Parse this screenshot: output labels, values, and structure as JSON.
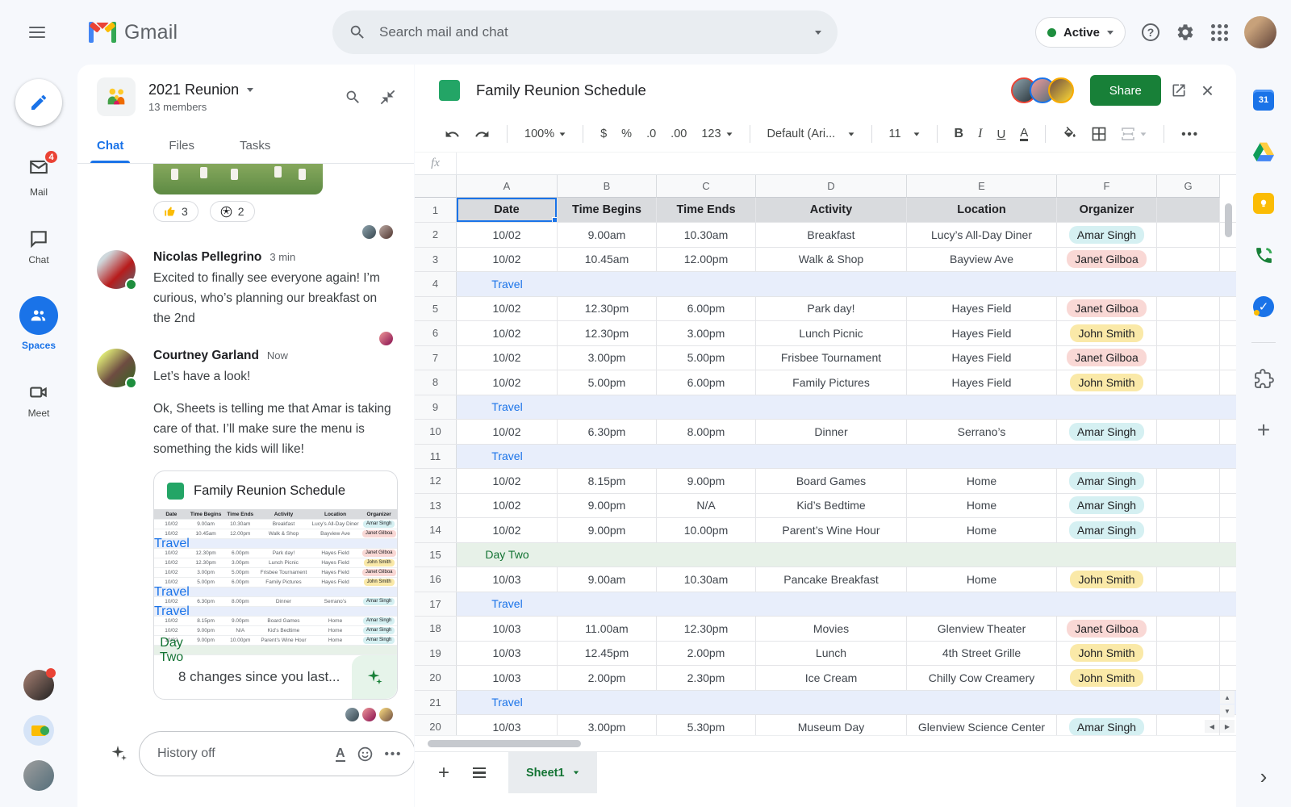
{
  "topbar": {
    "product": "Gmail",
    "search_placeholder": "Search mail and chat",
    "status": "Active"
  },
  "left_nav": {
    "items": [
      {
        "label": "Mail",
        "badge": "4"
      },
      {
        "label": "Chat"
      },
      {
        "label": "Spaces"
      },
      {
        "label": "Meet"
      }
    ]
  },
  "chat": {
    "space_title": "2021 Reunion",
    "members": "13 members",
    "tabs": [
      {
        "label": "Chat"
      },
      {
        "label": "Files"
      },
      {
        "label": "Tasks"
      }
    ],
    "reactions": [
      {
        "icon": "thumbs-up",
        "count": "3"
      },
      {
        "icon": "soccer-ball",
        "count": "2"
      }
    ],
    "messages": {
      "0": {
        "author": "Nicolas Pellegrino",
        "time": "3 min",
        "text": "Excited to finally see everyone again! I’m curious, who’s planning our breakfast on the 2nd"
      },
      "1": {
        "author": "Courtney Garland",
        "time": "Now",
        "text": "Let’s have a look!",
        "text2": "Ok, Sheets is telling me that Amar is taking care of that. I’ll make sure the menu is something the kids will like!"
      }
    },
    "card": {
      "title": "Family Reunion Schedule",
      "footer": "8 changes since you last..."
    },
    "composer": {
      "placeholder": "History off"
    }
  },
  "sheet": {
    "title": "Family Reunion Schedule",
    "share_label": "Share",
    "toolbar": {
      "zoom": "100%",
      "currency": "$",
      "percent": "%",
      "dec0": ".0",
      "dec00": ".00",
      "fmt": "123",
      "font": "Default (Ari...",
      "size": "11",
      "bold": "B",
      "italic": "I",
      "underline": "U",
      "textcolor": "A"
    },
    "formula_label": "fx",
    "columns": [
      "A",
      "B",
      "C",
      "D",
      "E",
      "F",
      "G"
    ],
    "header_row": [
      "Date",
      "Time Begins",
      "Time Ends",
      "Activity",
      "Location",
      "Organizer"
    ],
    "rows": [
      {
        "n": "2",
        "type": "data",
        "cells": [
          "10/02",
          "9.00am",
          "10.30am",
          "Breakfast",
          "Lucy’s All-Day Diner"
        ],
        "organizer": "Amar Singh",
        "chip": "cyan"
      },
      {
        "n": "3",
        "type": "data",
        "cells": [
          "10/02",
          "10.45am",
          "12.00pm",
          "Walk & Shop",
          "Bayview Ave"
        ],
        "organizer": "Janet Gilboa",
        "chip": "pink"
      },
      {
        "n": "4",
        "type": "travel",
        "label": "Travel"
      },
      {
        "n": "5",
        "type": "data",
        "cells": [
          "10/02",
          "12.30pm",
          "6.00pm",
          "Park day!",
          "Hayes Field"
        ],
        "organizer": "Janet Gilboa",
        "chip": "pink"
      },
      {
        "n": "6",
        "type": "data",
        "cells": [
          "10/02",
          "12.30pm",
          "3.00pm",
          "Lunch Picnic",
          "Hayes Field"
        ],
        "organizer": "John Smith",
        "chip": "yellow"
      },
      {
        "n": "7",
        "type": "data",
        "cells": [
          "10/02",
          "3.00pm",
          "5.00pm",
          "Frisbee Tournament",
          "Hayes Field"
        ],
        "organizer": "Janet Gilboa",
        "chip": "pink"
      },
      {
        "n": "8",
        "type": "data",
        "cells": [
          "10/02",
          "5.00pm",
          "6.00pm",
          "Family Pictures",
          "Hayes Field"
        ],
        "organizer": "John Smith",
        "chip": "yellow"
      },
      {
        "n": "9",
        "type": "travel",
        "label": "Travel"
      },
      {
        "n": "10",
        "type": "data",
        "cells": [
          "10/02",
          "6.30pm",
          "8.00pm",
          "Dinner",
          "Serrano’s"
        ],
        "organizer": "Amar Singh",
        "chip": "cyan"
      },
      {
        "n": "11",
        "type": "travel",
        "label": "Travel"
      },
      {
        "n": "12",
        "type": "data",
        "cells": [
          "10/02",
          "8.15pm",
          "9.00pm",
          "Board Games",
          "Home"
        ],
        "organizer": "Amar Singh",
        "chip": "cyan"
      },
      {
        "n": "13",
        "type": "data",
        "cells": [
          "10/02",
          "9.00pm",
          "N/A",
          "Kid’s Bedtime",
          "Home"
        ],
        "organizer": "Amar Singh",
        "chip": "cyan"
      },
      {
        "n": "14",
        "type": "data",
        "cells": [
          "10/02",
          "9.00pm",
          "10.00pm",
          "Parent’s Wine Hour",
          "Home"
        ],
        "organizer": "Amar Singh",
        "chip": "cyan"
      },
      {
        "n": "15",
        "type": "day",
        "label": "Day Two"
      },
      {
        "n": "16",
        "type": "data",
        "cells": [
          "10/03",
          "9.00am",
          "10.30am",
          "Pancake Breakfast",
          "Home"
        ],
        "organizer": "John Smith",
        "chip": "yellow"
      },
      {
        "n": "17",
        "type": "travel",
        "label": "Travel"
      },
      {
        "n": "18",
        "type": "data",
        "cells": [
          "10/03",
          "11.00am",
          "12.30pm",
          "Movies",
          "Glenview Theater"
        ],
        "organizer": "Janet Gilboa",
        "chip": "pink"
      },
      {
        "n": "19",
        "type": "data",
        "cells": [
          "10/03",
          "12.45pm",
          "2.00pm",
          "Lunch",
          "4th Street Grille"
        ],
        "organizer": "John Smith",
        "chip": "yellow"
      },
      {
        "n": "20",
        "type": "data",
        "cells": [
          "10/03",
          "2.00pm",
          "2.30pm",
          "Ice Cream",
          "Chilly Cow Creamery"
        ],
        "organizer": "John Smith",
        "chip": "yellow"
      },
      {
        "n": "21",
        "type": "travel",
        "label": "Travel"
      },
      {
        "n": "20",
        "type": "data",
        "cells": [
          "10/03",
          "3.00pm",
          "5.30pm",
          "Museum Day",
          "Glenview Science Center"
        ],
        "organizer": "Amar Singh",
        "chip": "cyan"
      }
    ],
    "tab_name": "Sheet1"
  },
  "right_rail": {
    "calendar_day": "31"
  }
}
